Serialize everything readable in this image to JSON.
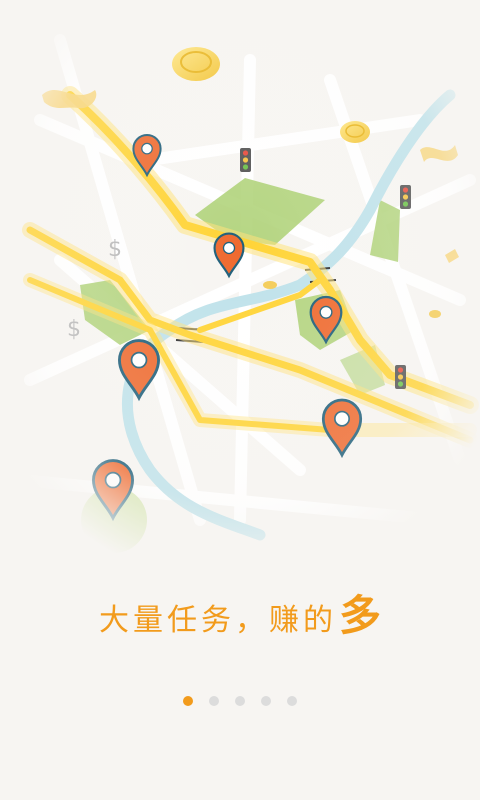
{
  "slide": {
    "tagline_main": "大量任务，赚的",
    "tagline_emphasis": "多",
    "accent_color": "#f29b1c"
  },
  "map_icons": {
    "pin": "map-pin-icon",
    "coin": "gold-coin-icon",
    "dollar": "dollar-icon",
    "traffic_light": "traffic-light-icon",
    "ribbon": "confetti-ribbon-icon",
    "dollar_symbol": "$"
  },
  "pager": {
    "count": 5,
    "active_index": 0
  }
}
